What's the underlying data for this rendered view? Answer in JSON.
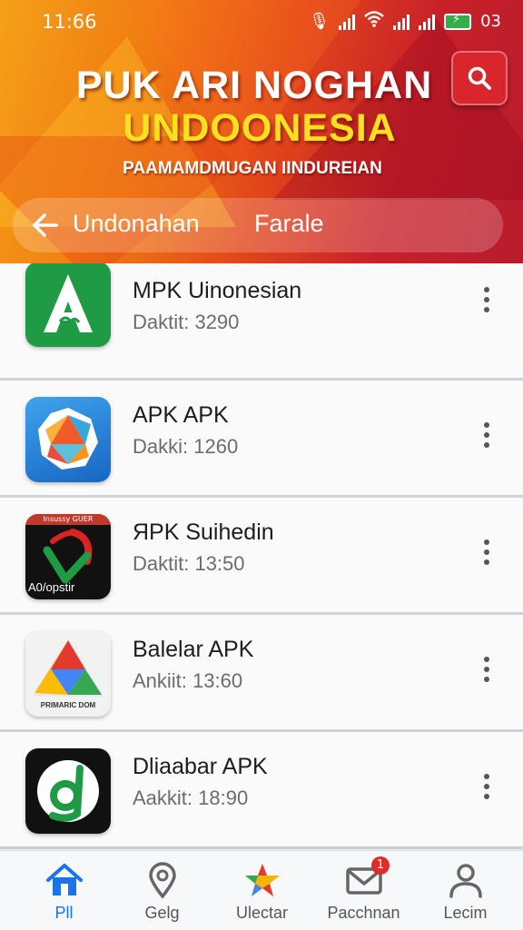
{
  "status_bar": {
    "time": "11:66",
    "battery_text": "03"
  },
  "header": {
    "title_line1": "PUK ARI NOGHAN",
    "title_line2": "UNDOONESIA",
    "subtitle": "PAAMAMDMUGAN IINDUREIAN",
    "nav_label_1": "Undonahan",
    "nav_label_2": "Farale"
  },
  "apps": [
    {
      "name": "MPK Uinonesian",
      "meta": "Daktit:  3290"
    },
    {
      "name": "APK APK",
      "meta": "Dakki:  1260"
    },
    {
      "name": "ЯPK Suihedin",
      "meta": "Daktit: 13:50",
      "icon_top_text": "Insussy GUER",
      "icon_bottom_text": "A0/opstir"
    },
    {
      "name": "Balelar APK",
      "meta": "Ankiit: 13:60",
      "icon_caption": "PRIMARIC DOM"
    },
    {
      "name": "Dliaabar APK",
      "meta": "Aakkit: 18:90"
    }
  ],
  "bottom_nav": [
    {
      "label": "Pll",
      "icon": "home-icon",
      "active": true
    },
    {
      "label": "Gelg",
      "icon": "location-pin-icon"
    },
    {
      "label": "Ulectar",
      "icon": "star-icon"
    },
    {
      "label": "Pacchnan",
      "icon": "mail-icon",
      "badge": "1"
    },
    {
      "label": "Lecim",
      "icon": "person-icon"
    }
  ],
  "colors": {
    "accent": "#1a73e8",
    "header_red": "#c8202a",
    "header_orange": "#f07a12",
    "title_yellow": "#ffe020"
  }
}
